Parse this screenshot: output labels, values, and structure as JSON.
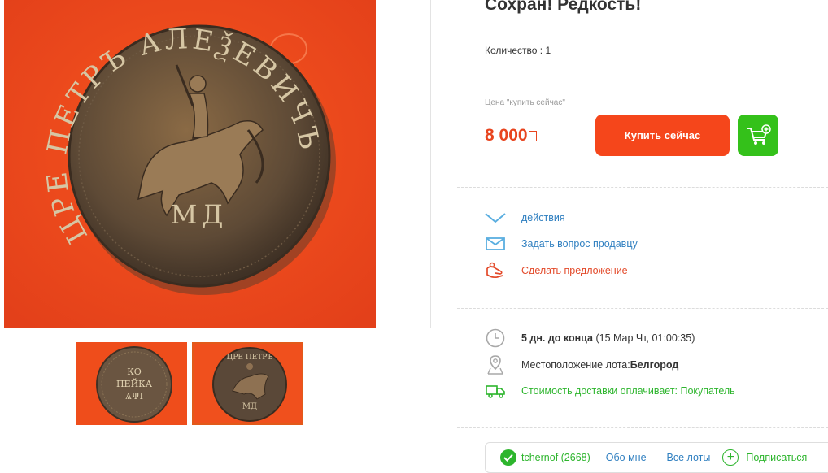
{
  "lot": {
    "title": "Сохран! Редкость!",
    "quantity": "Количество : 1"
  },
  "price": {
    "label": "Цена \"купить сейчас\"",
    "value": "8 000",
    "buy_now_label": "Купить сейчас"
  },
  "actions": {
    "actions_label": "действия",
    "ask_seller_label": "Задать вопрос продавцу",
    "make_offer_label": "Сделать предложение"
  },
  "details": {
    "time_left": "5 дн. до конца",
    "end_date": "(15 Мар Чт, 01:00:35)",
    "location_label": "Местоположение лота: ",
    "location_value": "Белгород",
    "shipping": "Стоимость доставки оплачивает: Покупатель"
  },
  "seller": {
    "nick": "tchernof (2668)",
    "about_label": "Обо мне",
    "lots_label": "Все лоты",
    "subscribe_label": "Подписаться"
  },
  "gallery": {
    "main_coin_legend": "ЦРЕ ПЕТРЪ АЛЕѮЕВИЧЪ",
    "main_coin_mint": "МД",
    "thumb1_lines": [
      "КО",
      "ПЕЙКА",
      "ѦΨΙ"
    ],
    "thumb2_coin_legend": "ЦРЕ ПЕТРЪ",
    "thumb2_coin_mint": "МД"
  },
  "colors": {
    "accent_orange": "#f5461b",
    "price_red": "#e8441e",
    "cart_green": "#34c11a",
    "link_blue": "#2f7fc0",
    "link_green": "#2db52d",
    "photo_bg": "#f04c1c"
  },
  "icons": {
    "actions": "chevron-down-icon",
    "ask": "envelope-icon",
    "offer": "hand-offer-icon",
    "time": "clock-icon",
    "location": "map-pin-icon",
    "shipping": "delivery-truck-icon",
    "cart": "cart-add-icon",
    "verified": "check-circle-icon",
    "subscribe": "plus-circle-icon"
  }
}
